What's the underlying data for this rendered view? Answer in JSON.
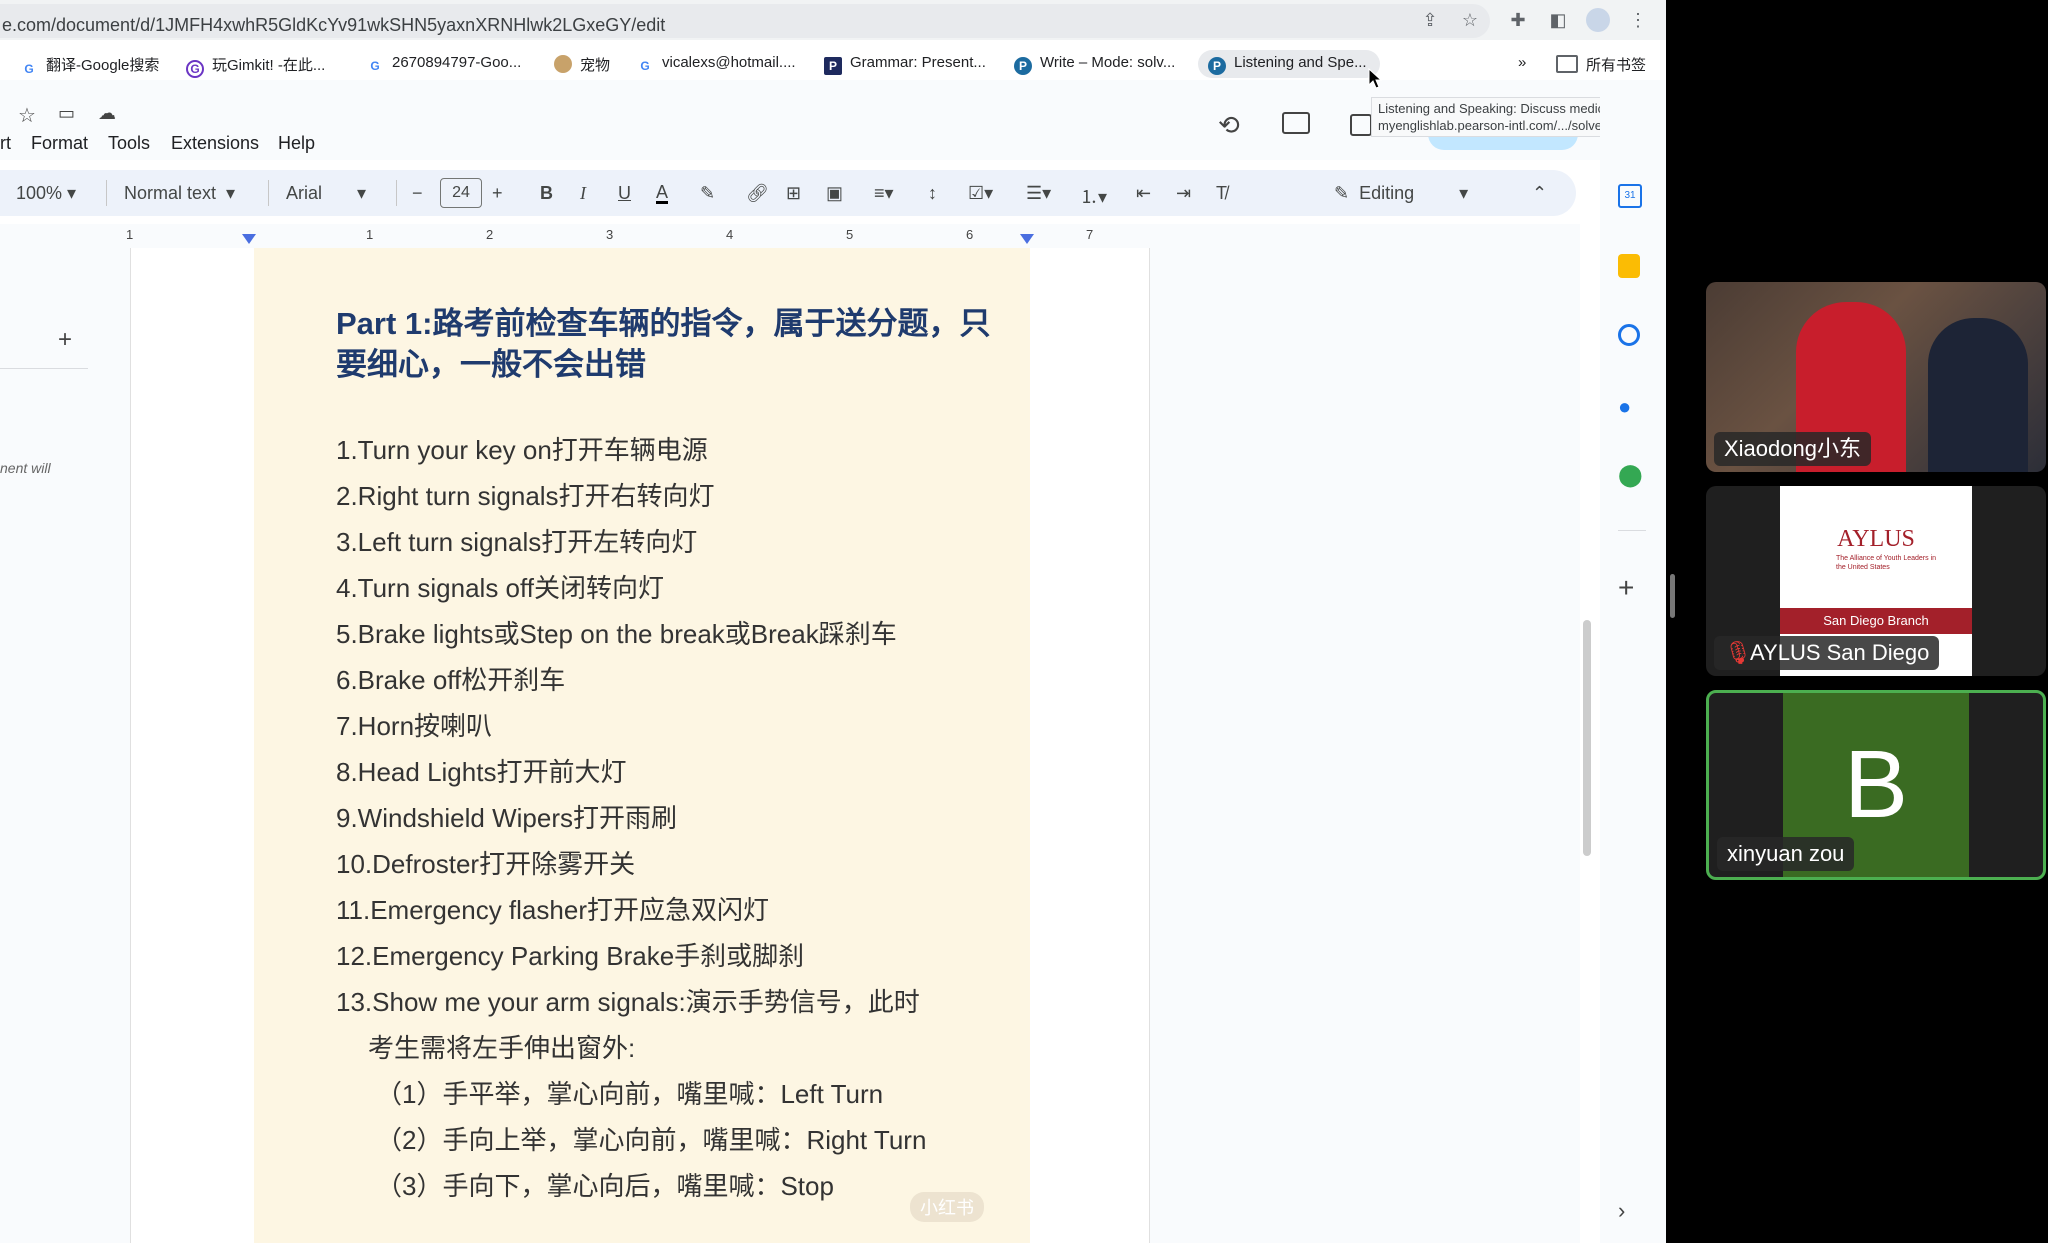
{
  "browser": {
    "url": "e.com/document/d/1JMFH4xwhR5GldKcYv91wkSHN5yaxnXRNHlwk2LGxeGY/edit",
    "bookmarks": [
      {
        "label": "翻译-Google搜索",
        "icon": "google-icon"
      },
      {
        "label": "玩Gimkit! -在此...",
        "icon": "gimkit-icon"
      },
      {
        "label": "2670894797-Goo...",
        "icon": "google-icon"
      },
      {
        "label": "宠物",
        "icon": "pet-icon"
      },
      {
        "label": "vicalexs@hotmail....",
        "icon": "google-icon"
      },
      {
        "label": "Grammar: Present...",
        "icon": "pearson-icon"
      },
      {
        "label": "Write – Mode: solv...",
        "icon": "pearson-icon"
      },
      {
        "label": "Listening and Spe...",
        "icon": "pearson-icon"
      }
    ],
    "more": "»",
    "all_bookmarks": "所有书签",
    "tooltip_title": "Listening and Speaking: Discuss medical pr",
    "tooltip_url": "myenglishlab.pearson-intl.com/.../solve"
  },
  "docs": {
    "menus": [
      "rt",
      "Format",
      "Tools",
      "Extensions",
      "Help"
    ],
    "toolbar": {
      "zoom": "100%",
      "style": "Normal text",
      "font": "Arial",
      "font_size": "24",
      "mode": "Editing"
    },
    "ruler_numbers": [
      "1",
      "1",
      "2",
      "3",
      "4",
      "5",
      "6",
      "7"
    ],
    "outline_add": "+",
    "side_note": "nent will"
  },
  "document": {
    "title": "Part  1:路考前检查车辆的指令，属于送分题，只要细心，一般不会出错",
    "lines": [
      "1.Turn your key on打开车辆电源",
      "2.Right turn signals打开右转向灯",
      "3.Left turn signals打开左转向灯",
      "4.Turn signals off关闭转向灯",
      "5.Brake lights或Step on the break或Break踩刹车",
      "6.Brake off松开刹车",
      "7.Horn按喇叭",
      "8.Head Lights打开前大灯",
      "9.Windshield Wipers打开雨刷",
      "10.Defroster打开除雾开关",
      "11.Emergency flasher打开应急双闪灯",
      "12.Emergency Parking Brake手刹或脚刹",
      "13.Show me your arm signals:演示手势信号，此时",
      "考生需将左手伸出窗外:",
      "（1）手平举，掌心向前，嘴里喊：Left Turn",
      "（2）手向上举，掌心向前，嘴里喊：Right Turn",
      "（3）手向下，掌心向后，嘴里喊：Stop"
    ],
    "watermark": "小红书"
  },
  "participants": [
    {
      "name": "Xiaodong小东"
    },
    {
      "name": "AYLUS San Diego",
      "logo_text": "AYLUS",
      "logo_sub": "The Alliance of Youth Leaders in the United States",
      "branch": "San Diego Branch"
    },
    {
      "name": "xinyuan zou",
      "initial": "B"
    }
  ]
}
